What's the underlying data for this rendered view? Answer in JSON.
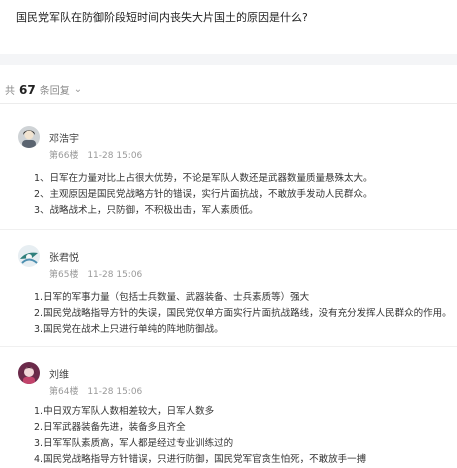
{
  "question": "国民党军队在防御阶段短时间内丧失大片国土的原因是什么?",
  "replies_summary": {
    "prefix": "共",
    "count": "67",
    "suffix": "条回复"
  },
  "replies": [
    {
      "author": "邓浩宇",
      "floor": "第66楼",
      "time": "11-28 15:06",
      "lines": [
        "1、日军在力量对比上占很大优势，不论是军队人数还是武器数量质量悬殊太大。",
        "2、主观原因是国民党战略方针的错误，实行片面抗战，不敢放手发动人民群众。",
        "3、战略战术上，只防御，不积极出击，军人素质低。"
      ]
    },
    {
      "author": "张君悦",
      "floor": "第65楼",
      "time": "11-28 15:06",
      "lines": [
        "1.日军的军事力量（包括士兵数量、武器装备、士兵素质等）强大",
        "2.国民党战略指导方针的失误，国民党仅单方面实行片面抗战路线，没有充分发挥人民群众的作用。",
        "3.国民党在战术上只进行单纯的阵地防御战。"
      ]
    },
    {
      "author": "刘维",
      "floor": "第64楼",
      "time": "11-28 15:06",
      "lines": [
        "1.中日双方军队人数相差较大，日军人数多",
        "2.日军武器装备先进，装备多且齐全",
        "3.日军军队素质高，军人都是经过专业训练过的",
        "4.国民党战略指导方针错误，只进行防御，国民党军官贪生怕死，不敢放手一搏"
      ]
    }
  ],
  "icons": {
    "count_arrow": "chevron-down-icon"
  },
  "colors": {
    "accent_band": "#f4f5f7",
    "meta_text": "#999999"
  }
}
